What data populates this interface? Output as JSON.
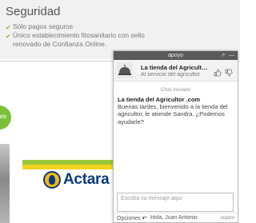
{
  "security": {
    "title": "Seguridad",
    "items": [
      "Sólo pagos seguros",
      "Único establecimiento fitosanitario con sello",
      "renovado de Confianza Online."
    ]
  },
  "page": {
    "badge_text": "VO",
    "banner_brand": "Actara",
    "colors": {
      "accent_green": "#7bbf3a",
      "band_yellow": "#f2d320",
      "brand_blue": "#0b3a7a"
    }
  },
  "chat": {
    "header_title": "apoyo",
    "agent": {
      "name": "La tienda del Agricultor .com",
      "tagline": "Al servicio del agricultor"
    },
    "status": "Chat iniciado",
    "message": {
      "sender": "La tienda del Agricultor .com",
      "text": "Buenas tardes, bienvenido a la tienda del agricultor, le atiende Sandra. ¿Podemos ayudarle?"
    },
    "input": {
      "placeholder": "Escriba su mensaje aquí",
      "value": ""
    },
    "footer": {
      "options_label": "Opciones ▾",
      "dot": "•",
      "greeting": "Hola, Juan Antonio",
      "brand": "zopim"
    }
  }
}
